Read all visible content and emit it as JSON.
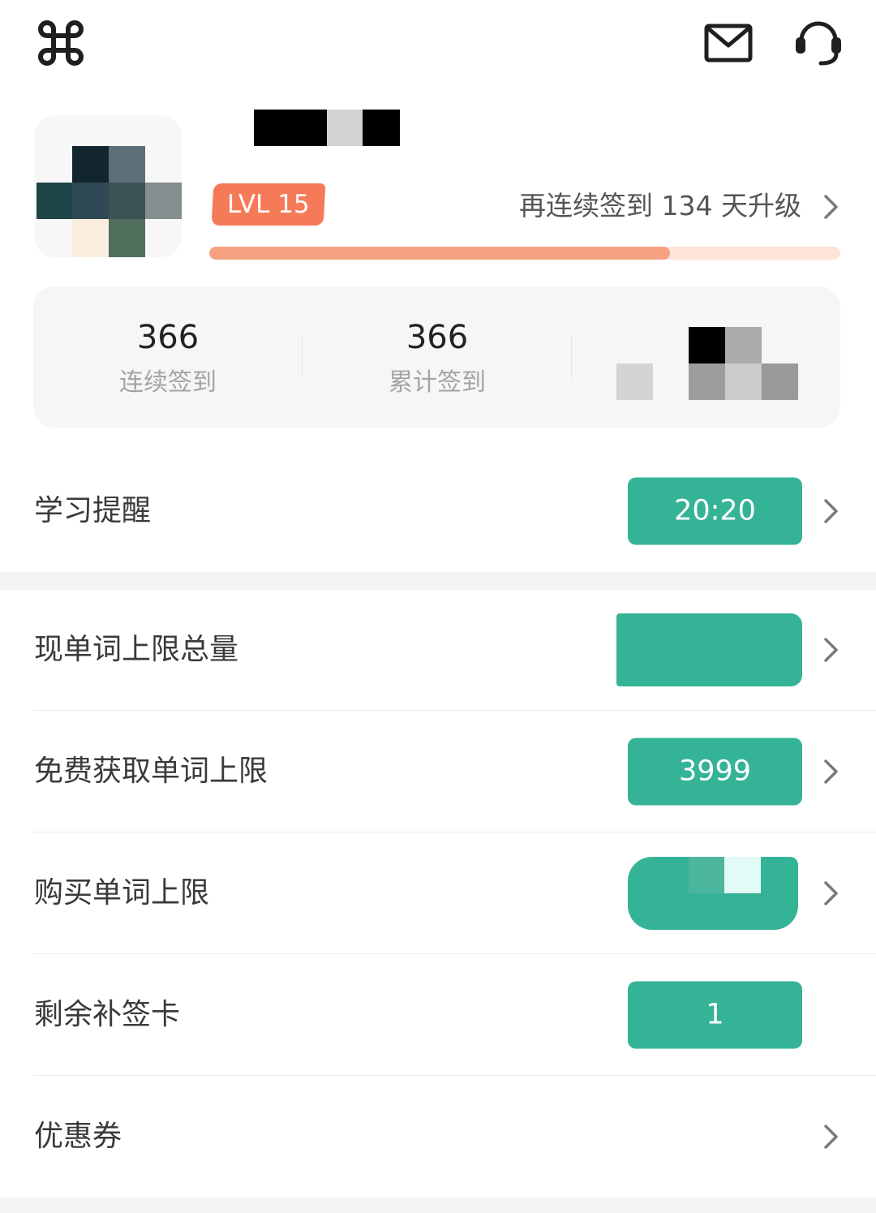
{
  "header": {
    "menu_icon": "command-grid-icon",
    "mail_icon": "envelope-icon",
    "support_icon": "headset-icon"
  },
  "profile": {
    "level_label": "LVL 15",
    "upgrade_text": "再连续签到 134 天升级",
    "level_progress_percent": 73
  },
  "stats": {
    "consecutive": {
      "value": "366",
      "label": "连续签到"
    },
    "total": {
      "value": "366",
      "label": "累计签到"
    }
  },
  "settings": {
    "reminder": {
      "label": "学习提醒",
      "value": "20:20"
    },
    "word_limit_total": {
      "label": "现单词上限总量",
      "value": ""
    },
    "free_word_limit": {
      "label": "免费获取单词上限",
      "value": "3999"
    },
    "buy_word_limit": {
      "label": "购买单词上限",
      "value": ""
    },
    "makeup_cards": {
      "label": "剩余补签卡",
      "value": "1"
    },
    "coupons": {
      "label": "优惠券"
    }
  },
  "colors": {
    "accent_green": "#35b396",
    "level_orange": "#f57a58",
    "progress_fill": "#f5a283",
    "progress_track": "#fde3da"
  }
}
